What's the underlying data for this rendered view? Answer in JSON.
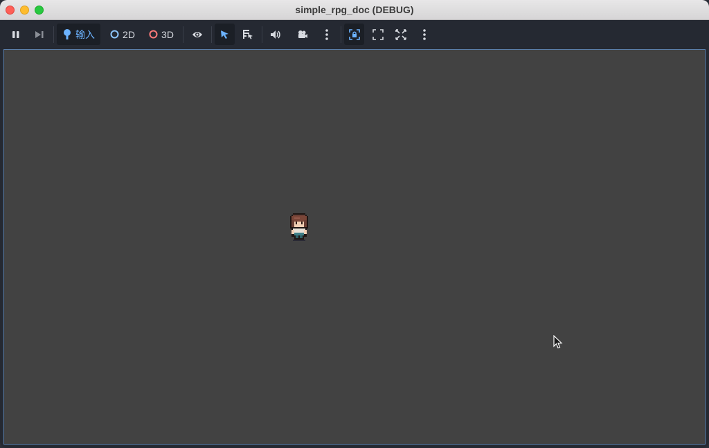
{
  "window": {
    "title": "simple_rpg_doc (DEBUG)"
  },
  "toolbar": {
    "pause": {
      "icon": "pause-icon"
    },
    "next_frame": {
      "icon": "next-frame-icon"
    },
    "input": {
      "label": "输入",
      "icon": "input-joystick-icon"
    },
    "mode_2d": {
      "label": "2D",
      "icon": "circle-2d-icon"
    },
    "mode_3d": {
      "label": "3D",
      "icon": "circle-3d-icon"
    },
    "visibility": {
      "icon": "eye-icon"
    },
    "select": {
      "icon": "pointer-icon"
    },
    "list_select": {
      "icon": "list-select-icon"
    },
    "audio": {
      "icon": "speaker-icon"
    },
    "camera": {
      "icon": "camera-icon"
    },
    "more_1": {
      "icon": "kebab-icon"
    },
    "camera_lock": {
      "icon": "lock-frame-icon"
    },
    "fit": {
      "icon": "fit-frame-icon"
    },
    "fullscreen": {
      "icon": "fullscreen-icon"
    },
    "more_2": {
      "icon": "kebab-icon"
    }
  },
  "colors": {
    "accent": "#6cb3ff",
    "viewport_bg": "#424242",
    "toolbar_bg": "#252932",
    "mode_2d": "#8fc8ff",
    "mode_3d": "#ff7b7b"
  }
}
